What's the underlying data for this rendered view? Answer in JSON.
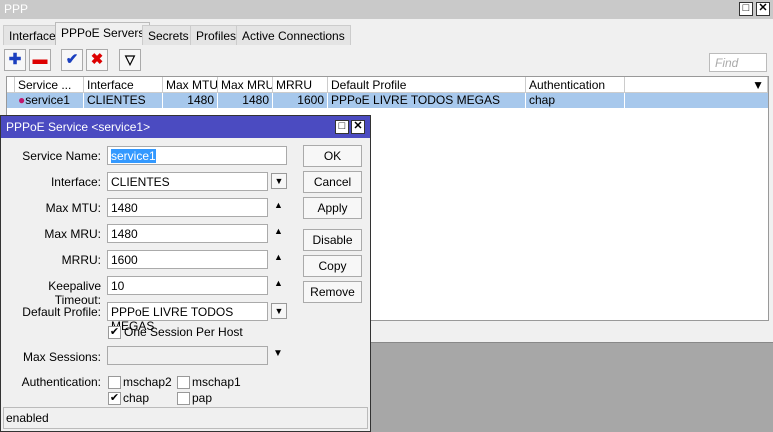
{
  "window": {
    "title": "PPP"
  },
  "tabs": [
    "Interface",
    "PPPoE Servers",
    "Secrets",
    "Profiles",
    "Active Connections"
  ],
  "find_placeholder": "Find",
  "table": {
    "headers": [
      "Service ...",
      "Interface",
      "Max MTU",
      "Max MRU",
      "MRRU",
      "Default Profile",
      "Authentication"
    ],
    "rows": [
      {
        "service": "service1",
        "interface": "CLIENTES",
        "mtu": "1480",
        "mru": "1480",
        "mrru": "1600",
        "profile": "PPPoE LIVRE TODOS MEGAS",
        "auth": "chap"
      }
    ]
  },
  "dialog": {
    "title": "PPPoE Service <service1>",
    "labels": {
      "service_name": "Service Name:",
      "interface": "Interface:",
      "mtu": "Max MTU:",
      "mru": "Max MRU:",
      "mrru": "MRRU:",
      "keepalive": "Keepalive Timeout:",
      "profile": "Default Profile:",
      "max_sessions": "Max Sessions:",
      "auth": "Authentication:"
    },
    "values": {
      "service_name": "service1",
      "interface": "CLIENTES",
      "mtu": "1480",
      "mru": "1480",
      "mrru": "1600",
      "keepalive": "10",
      "profile": "PPPoE LIVRE TODOS MEGAS",
      "max_sessions": ""
    },
    "one_session": "One Session Per Host",
    "auth_opts": {
      "mschap2": "mschap2",
      "mschap1": "mschap1",
      "chap": "chap",
      "pap": "pap"
    },
    "buttons": [
      "OK",
      "Cancel",
      "Apply",
      "Disable",
      "Copy",
      "Remove"
    ],
    "status": "enabled"
  }
}
